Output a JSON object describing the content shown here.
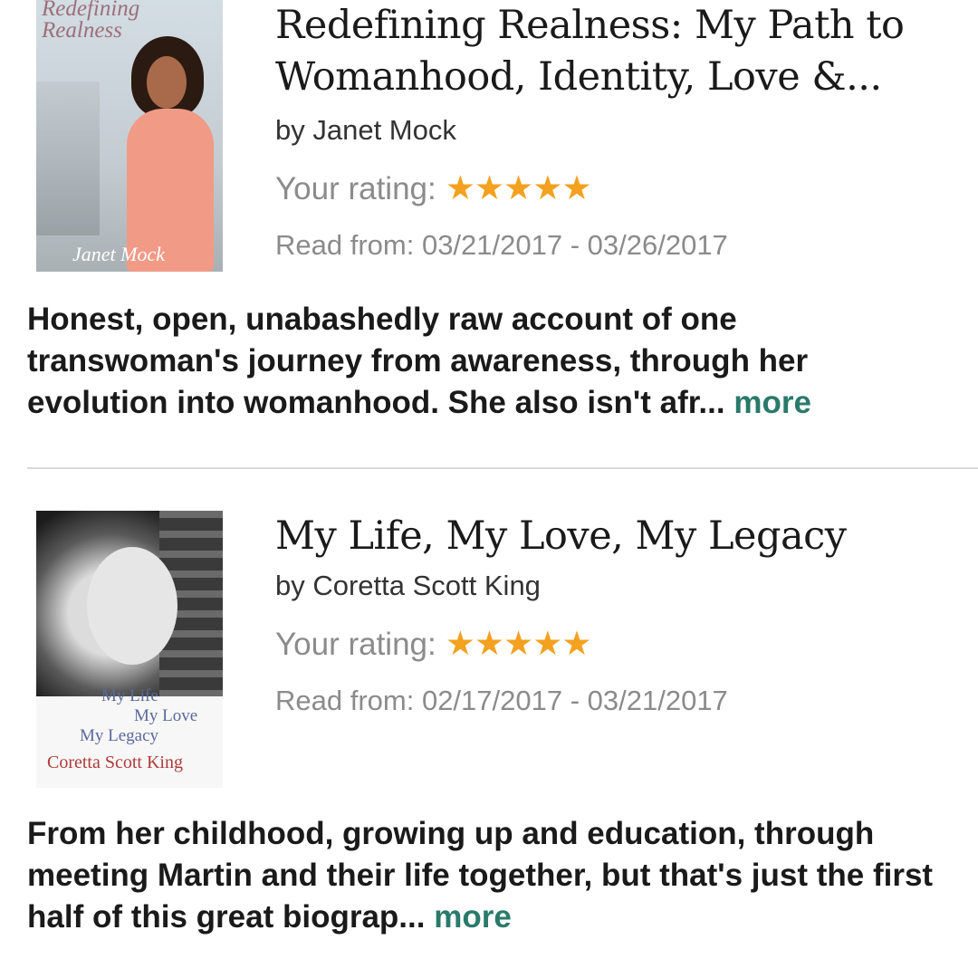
{
  "books": [
    {
      "cover_title": "Redefining Realness",
      "cover_author": "Janet Mock",
      "title": "Redefining Realness: My Path to Womanhood, Identity, Love &...",
      "author": "by Janet Mock",
      "rating_label": "Your rating:",
      "stars": "★★★★★",
      "rating": 5,
      "dates": "Read from: 03/21/2017 - 03/26/2017",
      "review": "Honest, open, unabashedly raw account of one transwoman's journey from awareness, through her evolution into womanhood. She also isn't afr... ",
      "more_label": "more"
    },
    {
      "cover_title_lines": [
        "My Life",
        "My Love",
        "My Legacy"
      ],
      "cover_author": "Coretta Scott King",
      "title": "My Life, My Love, My Legacy",
      "author": "by Coretta Scott King",
      "rating_label": "Your rating:",
      "stars": "★★★★★",
      "rating": 5,
      "dates": "Read from: 02/17/2017 - 03/21/2017",
      "review": "From her childhood, growing up and education, through meeting Martin and their life together, but that's just the first half of this great biograp... ",
      "more_label": "more"
    }
  ],
  "colors": {
    "stars": "#f3a11f",
    "more_link": "#2a7a6a",
    "muted_text": "#8b8b8b"
  }
}
